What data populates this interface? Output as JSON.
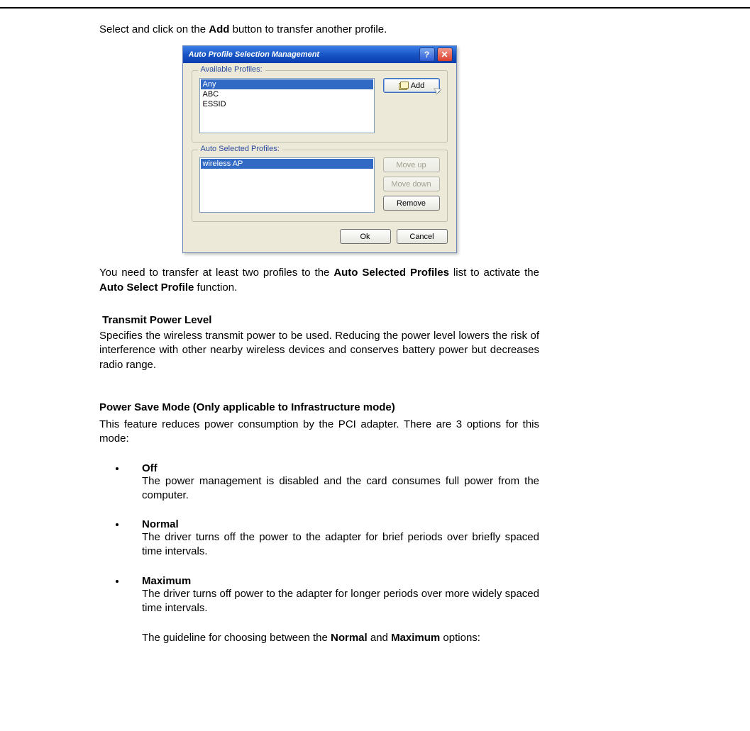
{
  "doc": {
    "intro_prefix": "Select and click on the ",
    "intro_bold": "Add",
    "intro_suffix": " button to transfer another profile.",
    "transfer_prefix": "You need to transfer at least two profiles to the ",
    "transfer_bold1": "Auto Selected Profiles",
    "transfer_mid": " list to activate the ",
    "transfer_bold2": "Auto Select Profile",
    "transfer_suffix": " function.",
    "tpl_heading": "Transmit Power Level",
    "tpl_body": "Specifies the wireless transmit power to be used. Reducing the power level lowers the risk of interference with other nearby wireless devices and conserves battery power but decreases radio range.",
    "psm_heading": "Power Save Mode (Only applicable to Infrastructure mode)",
    "psm_intro": "This feature reduces power consumption by the PCI adapter. There are 3 options for this mode:",
    "options": {
      "off": {
        "title": "Off",
        "body": "The power management is disabled and the card consumes full power from the computer."
      },
      "normal": {
        "title": "Normal",
        "body": "The driver turns off the power to the adapter for brief periods over briefly spaced time intervals."
      },
      "max": {
        "title": "Maximum",
        "body": "The driver turns off power to the adapter for longer periods over more widely spaced time intervals.",
        "guideline_prefix": "The guideline for choosing between the ",
        "guideline_b1": "Normal",
        "guideline_mid": " and ",
        "guideline_b2": "Maximum",
        "guideline_suffix": " options:"
      }
    }
  },
  "dialog": {
    "title": "Auto Profile Selection Management",
    "help_glyph": "?",
    "close_glyph": "✕",
    "available_legend": "Available Profiles:",
    "available_items": {
      "0": "Any",
      "1": "ABC",
      "2": "ESSID"
    },
    "selected_legend": "Auto Selected Profiles:",
    "selected_items": {
      "0": "wireless AP"
    },
    "buttons": {
      "add": "Add",
      "move_up": "Move up",
      "move_down": "Move down",
      "remove": "Remove",
      "ok": "Ok",
      "cancel": "Cancel"
    }
  }
}
